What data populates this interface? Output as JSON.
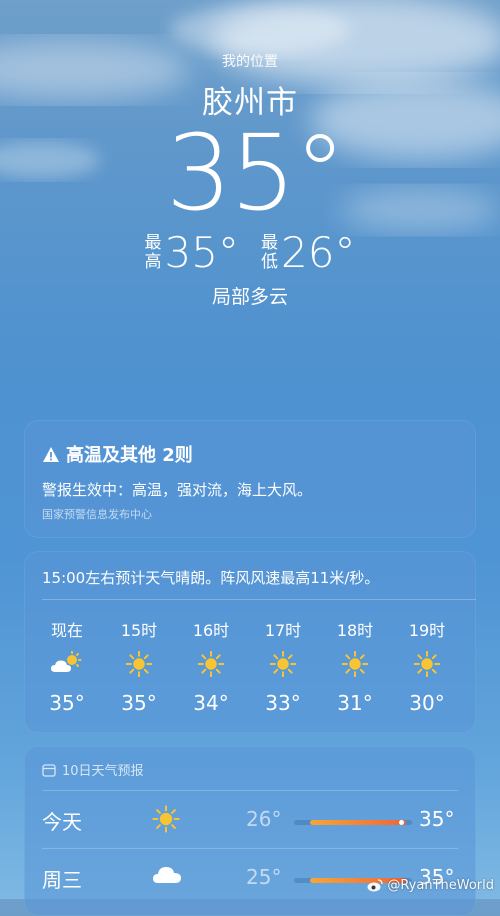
{
  "header": {
    "location_label": "我的位置",
    "city": "胶州市",
    "temperature": "35°",
    "high_label": "最高",
    "high_value": "35°",
    "low_label": "最低",
    "low_value": "26°",
    "condition": "局部多云"
  },
  "alert": {
    "title": "高温及其他 2则",
    "text": "警报生效中：高温，强对流，海上大风。",
    "source": "国家预警信息发布中心"
  },
  "hourly": {
    "summary": "15:00左右预计天气晴朗。阵风风速最高11米/秒。",
    "items": [
      {
        "time": "现在",
        "icon": "partly-cloudy-icon",
        "temp": "35°"
      },
      {
        "time": "15时",
        "icon": "sun-icon",
        "temp": "35°"
      },
      {
        "time": "16时",
        "icon": "sun-icon",
        "temp": "34°"
      },
      {
        "time": "17时",
        "icon": "sun-icon",
        "temp": "33°"
      },
      {
        "time": "18时",
        "icon": "sun-icon",
        "temp": "31°"
      },
      {
        "time": "19时",
        "icon": "sun-icon",
        "temp": "30°"
      }
    ]
  },
  "daily": {
    "header": "10日天气预报",
    "rows": [
      {
        "day": "今天",
        "icon": "sun-icon",
        "low": "26°",
        "high": "35°"
      },
      {
        "day": "周三",
        "icon": "cloud-icon",
        "low": "25°",
        "high": "35°"
      }
    ]
  },
  "watermark": "@RyanTheWorld",
  "colors": {
    "sky_top": "#6f9fca",
    "sky_bottom": "#7db8e3",
    "card": "#5a96d7",
    "sun": "#f7c531",
    "bar_start": "#f5a63a",
    "bar_end": "#f06535"
  }
}
